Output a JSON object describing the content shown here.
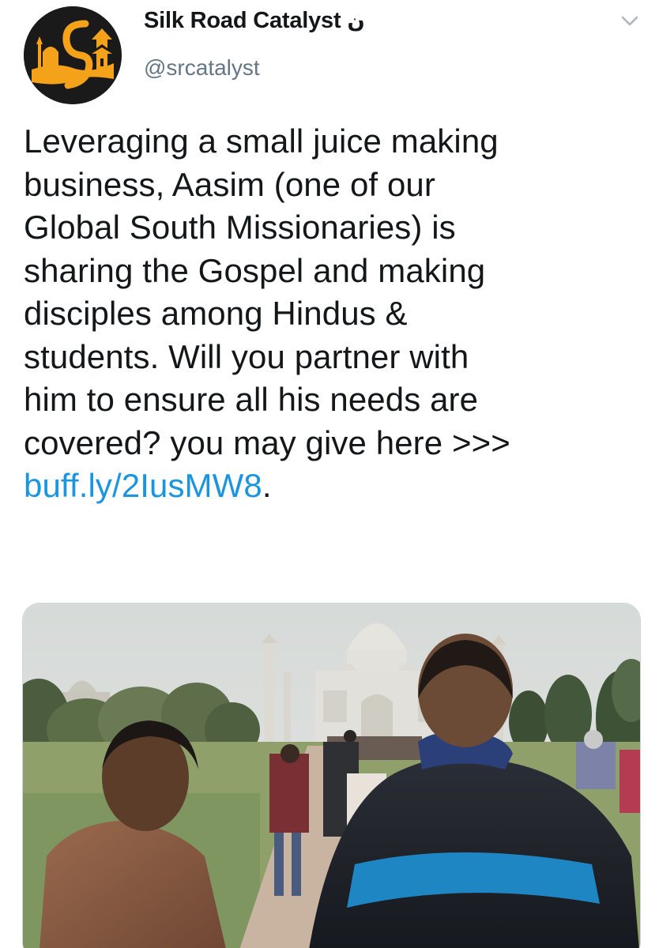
{
  "account": {
    "display_name": "Silk Road Catalyst",
    "name_suffix": "ن",
    "handle": "@srcatalyst",
    "avatar_icon": "silk-road-catalyst-logo",
    "avatar_colors": {
      "background": "#1a1a1a",
      "logo": "#f5a21b"
    }
  },
  "menu": {
    "icon": "chevron-down-icon",
    "color": "#aab8c2"
  },
  "tweet": {
    "lines": [
      "Leveraging a small juice making",
      "business, Aasim (one of our",
      "Global South Missionaries) is",
      "sharing the Gospel and making",
      "disciples among Hindus &",
      "students. Will you partner with",
      "him to ensure all his needs are",
      "covered? you may give here >>>"
    ],
    "link_text": "buff.ly/2IusMW8",
    "link_trailing": ".",
    "link_color": "#1b95e0"
  },
  "media": {
    "type": "photo",
    "description_icon": "taj-mahal-photo"
  }
}
